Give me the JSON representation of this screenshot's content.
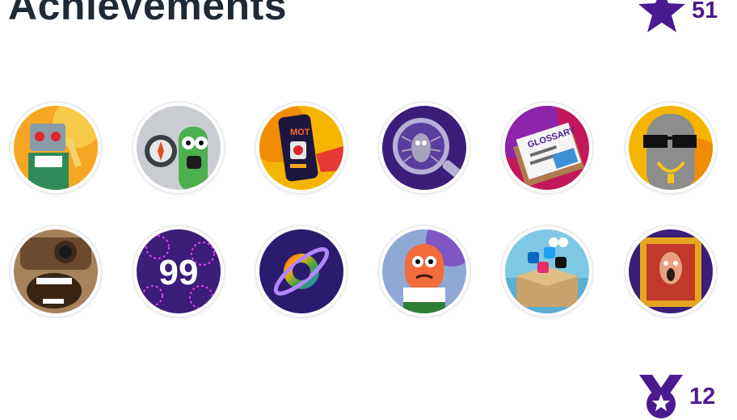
{
  "header": {
    "title": "Achievements"
  },
  "stats": {
    "stars": {
      "icon": "star-icon",
      "value": "51",
      "color": "#4b1a8f"
    },
    "medals": {
      "icon": "medal-icon",
      "value": "12",
      "color": "#4b1a8f"
    }
  },
  "badges": [
    {
      "icon": "robot-badge-icon"
    },
    {
      "icon": "compass-cucumber-badge-icon"
    },
    {
      "icon": "phone-app-badge-icon"
    },
    {
      "icon": "bug-magnifier-badge-icon"
    },
    {
      "icon": "glossary-book-badge-icon"
    },
    {
      "icon": "cool-sunglasses-badge-icon"
    },
    {
      "icon": "camera-laugh-badge-icon"
    },
    {
      "icon": "fireworks-99-badge-icon"
    },
    {
      "icon": "rainbow-planet-badge-icon"
    },
    {
      "icon": "orange-monster-badge-icon"
    },
    {
      "icon": "social-box-badge-icon"
    },
    {
      "icon": "framed-painting-badge-icon"
    }
  ],
  "badge_labels": {
    "fireworks_number": "99",
    "glossary_text": "GLOSSARY",
    "phone_text": "MOT"
  }
}
